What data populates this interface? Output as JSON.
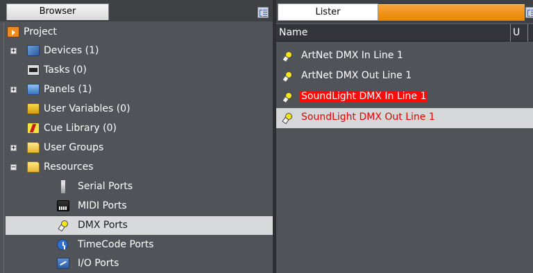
{
  "browser": {
    "tab_label": "Browser",
    "tree": [
      {
        "label": "Project",
        "icon": "project-icon",
        "expander": ""
      },
      {
        "label": "Devices (1)",
        "icon": "devices-icon",
        "expander": "+"
      },
      {
        "label": "Tasks (0)",
        "icon": "tasks-icon",
        "expander": ""
      },
      {
        "label": "Panels (1)",
        "icon": "panels-icon",
        "expander": "+"
      },
      {
        "label": "User Variables (0)",
        "icon": "user-variables-icon",
        "expander": ""
      },
      {
        "label": "Cue Library (0)",
        "icon": "cue-library-icon",
        "expander": ""
      },
      {
        "label": "User Groups",
        "icon": "folder-icon",
        "expander": "+"
      },
      {
        "label": "Resources",
        "icon": "folder-icon",
        "expander": "−"
      },
      {
        "label": "Serial Ports",
        "icon": "serial-port-icon",
        "expander": ""
      },
      {
        "label": "MIDI Ports",
        "icon": "midi-port-icon",
        "expander": ""
      },
      {
        "label": "DMX Ports",
        "icon": "dmx-port-icon",
        "expander": "",
        "selected": true
      },
      {
        "label": "TimeCode Ports",
        "icon": "timecode-icon",
        "expander": ""
      },
      {
        "label": "I/O Ports",
        "icon": "io-port-icon",
        "expander": ""
      }
    ]
  },
  "lister": {
    "tab_label": "Lister",
    "columns": {
      "name": "Name",
      "u": "U"
    },
    "rows": [
      {
        "label": "ArtNet DMX In Line 1",
        "style": "normal"
      },
      {
        "label": "ArtNet DMX Out Line 1",
        "style": "normal"
      },
      {
        "label": "SoundLight DMX In Line 1",
        "style": "red-highlight"
      },
      {
        "label": "SoundLight DMX Out Line 1",
        "style": "red-text",
        "selected": true
      }
    ]
  },
  "colors": {
    "panel_bg": "#505357",
    "selection_bg": "#d6d7d8",
    "accent_orange": "#f29400",
    "error_red": "#ff0a0a"
  }
}
